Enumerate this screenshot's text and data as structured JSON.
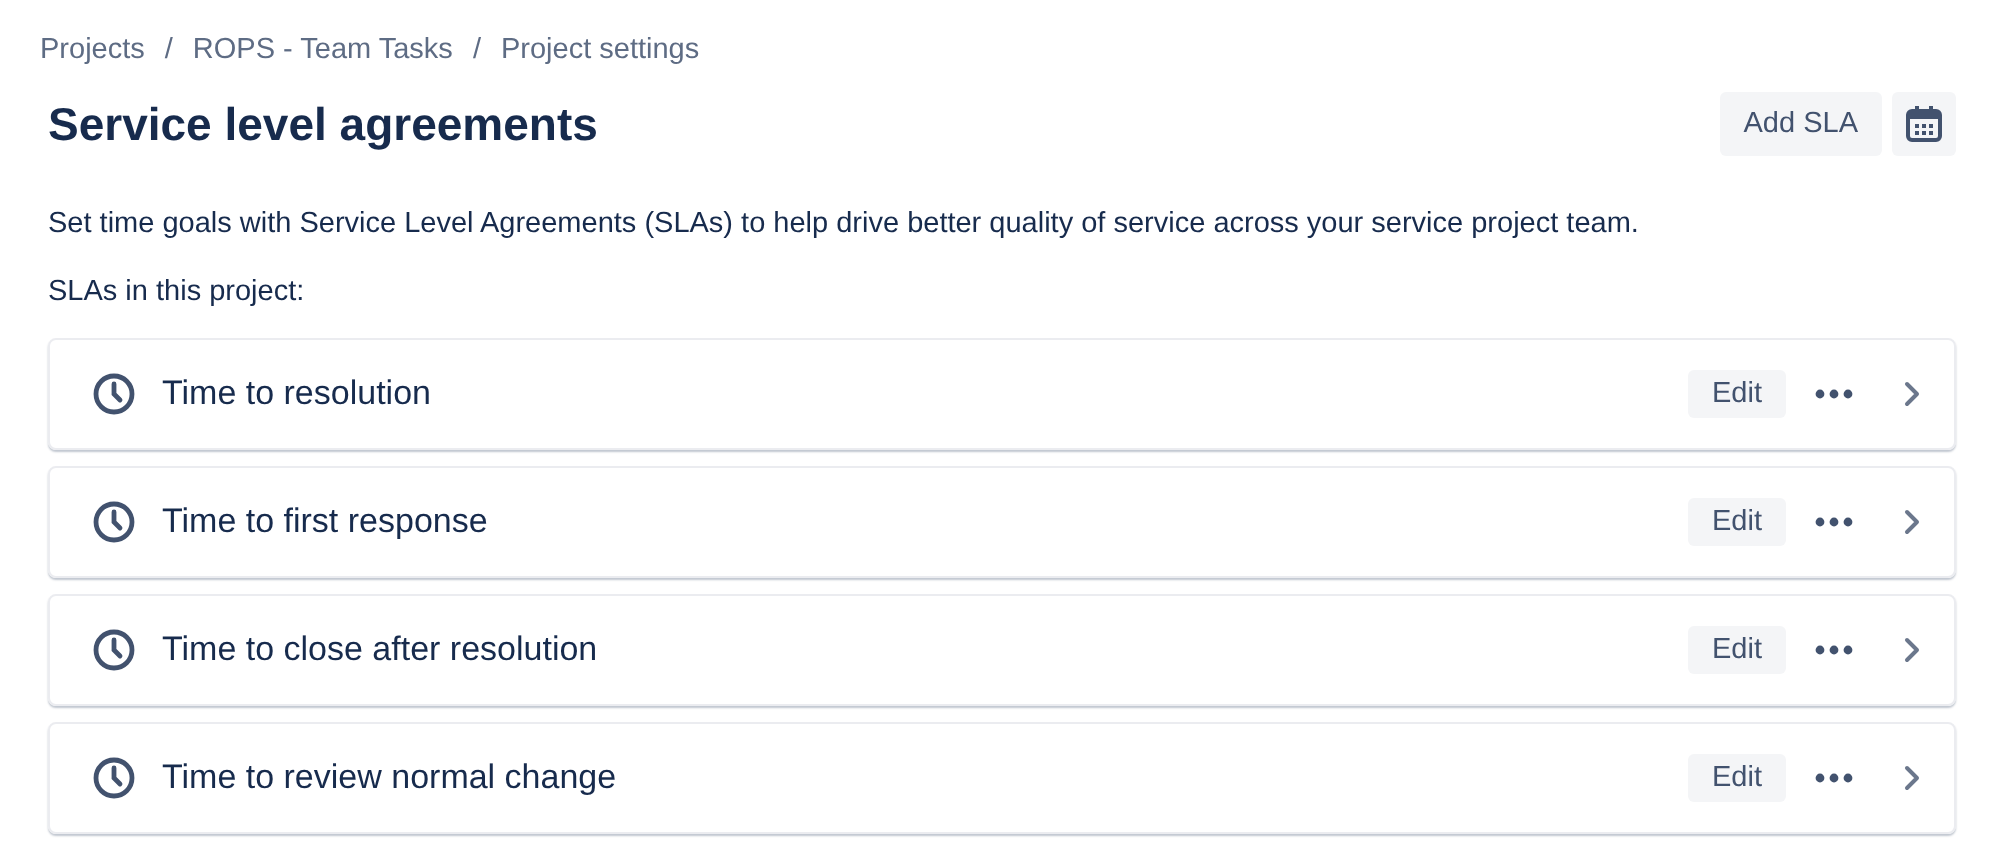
{
  "breadcrumbs": {
    "separator": "/",
    "items": [
      "Projects",
      "ROPS - Team Tasks",
      "Project settings"
    ]
  },
  "page_title": "Service level agreements",
  "actions": {
    "add_button": "Add SLA"
  },
  "description": "Set time goals with Service Level Agreements (SLAs) to help drive better quality of service across your service project team.",
  "list_heading": "SLAs in this project:",
  "slas": [
    {
      "name": "Time to resolution",
      "edit": "Edit"
    },
    {
      "name": "Time to first response",
      "edit": "Edit"
    },
    {
      "name": "Time to close after resolution",
      "edit": "Edit"
    },
    {
      "name": "Time to review normal change",
      "edit": "Edit"
    }
  ]
}
